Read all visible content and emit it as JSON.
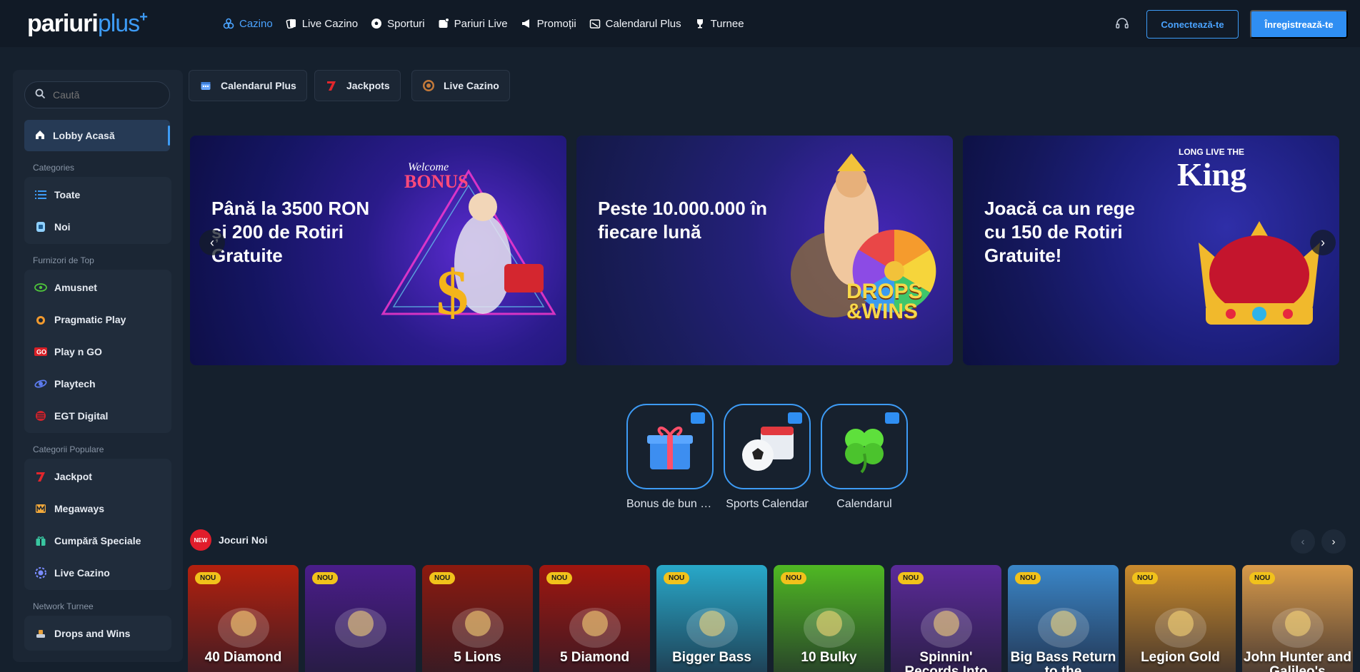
{
  "header": {
    "logo_part1": "pariuri",
    "logo_part2": "plus",
    "logo_plus": "+",
    "nav": [
      {
        "label": "Cazino",
        "icon": "dice-icon",
        "active": true
      },
      {
        "label": "Live Cazino",
        "icon": "cards-icon"
      },
      {
        "label": "Sporturi",
        "icon": "soccer-ball-icon"
      },
      {
        "label": "Pariuri Live",
        "icon": "live-icon"
      },
      {
        "label": "Promoții",
        "icon": "megaphone-icon"
      },
      {
        "label": "Calendarul Plus",
        "icon": "calendar-icon"
      },
      {
        "label": "Turnee",
        "icon": "trophy-icon"
      }
    ],
    "login_label": "Conectează-te",
    "register_label": "Înregistrează-te"
  },
  "sidebar": {
    "search_placeholder": "Caută",
    "lobby_label": "Lobby Acasă",
    "categories_title": "Categories",
    "categories": [
      {
        "label": "Toate",
        "icon": "list-icon"
      },
      {
        "label": "Noi",
        "icon": "new-icon"
      }
    ],
    "providers_title": "Furnizori de Top",
    "providers": [
      {
        "label": "Amusnet",
        "icon": "amusnet-icon"
      },
      {
        "label": "Pragmatic Play",
        "icon": "pragmatic-icon"
      },
      {
        "label": "Play n GO",
        "icon": "playngo-icon"
      },
      {
        "label": "Playtech",
        "icon": "playtech-icon"
      },
      {
        "label": "EGT Digital",
        "icon": "egt-icon"
      }
    ],
    "popular_title": "Categorii Populare",
    "popular": [
      {
        "label": "Jackpot",
        "icon": "seven-icon"
      },
      {
        "label": "Megaways",
        "icon": "megaways-icon"
      },
      {
        "label": "Cumpără Speciale",
        "icon": "gift-icon"
      },
      {
        "label": "Live Cazino",
        "icon": "chip-icon"
      }
    ],
    "network_title": "Network Turnee",
    "network": [
      {
        "label": "Drops and Wins",
        "icon": "drops-icon"
      }
    ]
  },
  "quick_links": [
    {
      "label": "Calendarul Plus",
      "icon": "calendar-icon"
    },
    {
      "label": "Jackpots",
      "icon": "seven-icon"
    },
    {
      "label": "Live Cazino",
      "icon": "chip-icon"
    }
  ],
  "banners": [
    {
      "text": "Până la 3500 RON și 200 de Rotiri Gratuite",
      "brand": "Welcome",
      "brand2": "BONUS"
    },
    {
      "text": "Peste 10.000.000 în fiecare lună",
      "brand": "DROPS",
      "brand2": "&WINS"
    },
    {
      "text": "Joacă ca un rege cu 150 de Rotiri Gratuite!",
      "brand": "LONG LIVE THE",
      "brand2": "King"
    }
  ],
  "promos": [
    {
      "label": "Bonus de bun v...",
      "icon": "gift-box-icon"
    },
    {
      "label": "Sports Calendar",
      "icon": "soccer-calendar-icon"
    },
    {
      "label": "Calendarul",
      "icon": "clover-icon"
    }
  ],
  "new_games": {
    "badge": "NEW",
    "title": "Jocuri Noi",
    "tiles": [
      {
        "name": "40 Diamond",
        "nou": "NOU",
        "bg": "#b3200e"
      },
      {
        "name": "",
        "nou": "NOU",
        "bg": "#4a1d8a"
      },
      {
        "name": "5 Lions",
        "nou": "NOU",
        "bg": "#8c1a0f"
      },
      {
        "name": "5 Diamond",
        "nou": "NOU",
        "bg": "#a0160f"
      },
      {
        "name": "Bigger Bass",
        "nou": "NOU",
        "bg": "#28a8c9"
      },
      {
        "name": "10 Bulky",
        "nou": "NOU",
        "bg": "#4fb823"
      },
      {
        "name": "Spinnin' Records Into",
        "nou": "NOU",
        "bg": "#5b2a99"
      },
      {
        "name": "Big Bass Return to the",
        "nou": "NOU",
        "bg": "#3a86c8"
      },
      {
        "name": "Legion Gold",
        "nou": "NOU",
        "bg": "#c98a2d"
      },
      {
        "name": "John Hunter and Galileo's",
        "nou": "NOU",
        "bg": "#d89a4a"
      }
    ]
  }
}
